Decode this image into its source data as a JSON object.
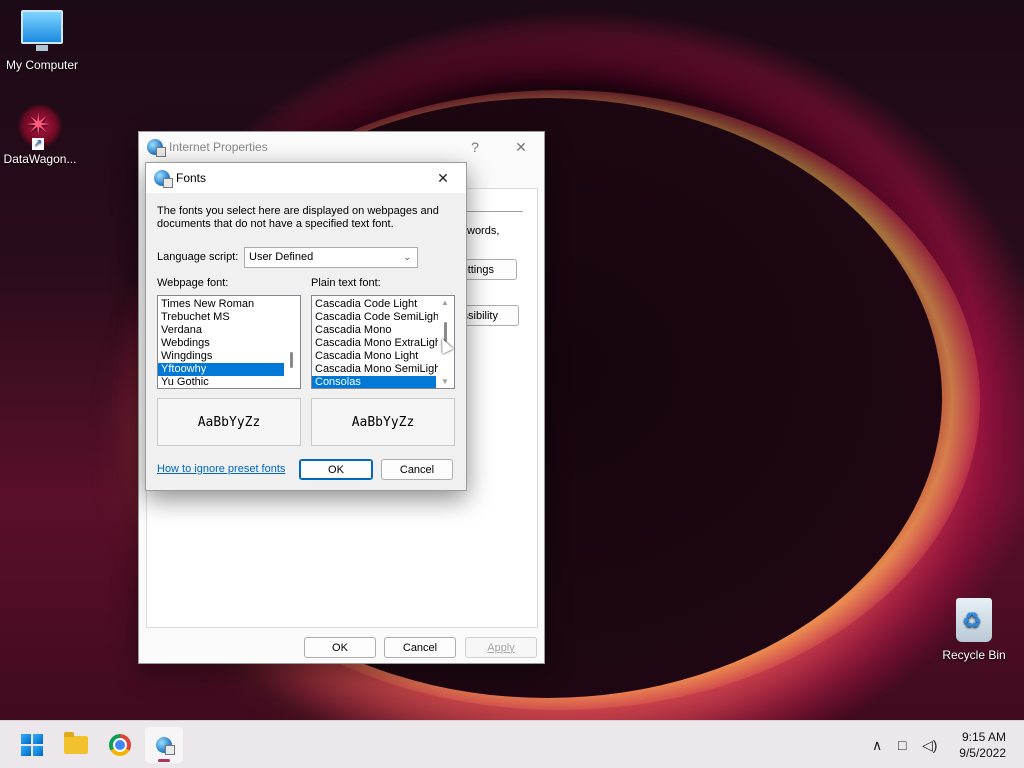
{
  "desktop": {
    "icons": [
      {
        "label": "My Computer"
      },
      {
        "label": "DataWagon..."
      },
      {
        "label": "Recycle Bin"
      }
    ]
  },
  "internet_properties": {
    "title": "Internet Properties",
    "help_glyph": "?",
    "close_glyph": "✕",
    "background_fragments": {
      "words": "words,",
      "settings": "ettings",
      "accessibility": "essibility"
    },
    "buttons": {
      "ok": "OK",
      "cancel": "Cancel",
      "apply": "Apply"
    }
  },
  "fonts_dialog": {
    "title": "Fonts",
    "close_glyph": "✕",
    "description": "The fonts you select here are displayed on webpages and documents that do not have a specified text font.",
    "language_script_label": "Language script:",
    "language_script_value": "User Defined",
    "webpage_font_label": "Webpage font:",
    "plain_text_font_label": "Plain text font:",
    "webpage_fonts": [
      "Times New Roman",
      "Trebuchet MS",
      "Verdana",
      "Webdings",
      "Wingdings",
      "Yftoowhy",
      "Yu Gothic"
    ],
    "webpage_selected": "Yftoowhy",
    "plain_text_fonts": [
      "Cascadia Code Light",
      "Cascadia Code SemiLight",
      "Cascadia Mono",
      "Cascadia Mono ExtraLight",
      "Cascadia Mono Light",
      "Cascadia Mono SemiLight",
      "Consolas"
    ],
    "plain_text_selected": "Consolas",
    "webpage_preview": "AaBbYyZz",
    "plain_text_preview": "AaBbYyZz",
    "help_link": "How to ignore preset fonts",
    "ok_label": "OK",
    "cancel_label": "Cancel"
  },
  "taskbar": {
    "apps": [
      "start",
      "file-explorer",
      "chrome",
      "internet-properties"
    ],
    "time": "9:15 AM",
    "date": "9/5/2022",
    "tray_glyphs": {
      "overflow": "∧",
      "network": "□",
      "volume": "◁)"
    }
  },
  "colors": {
    "selection": "#0078d7",
    "link": "#0067c0",
    "accent_indicator": "#b03060"
  }
}
